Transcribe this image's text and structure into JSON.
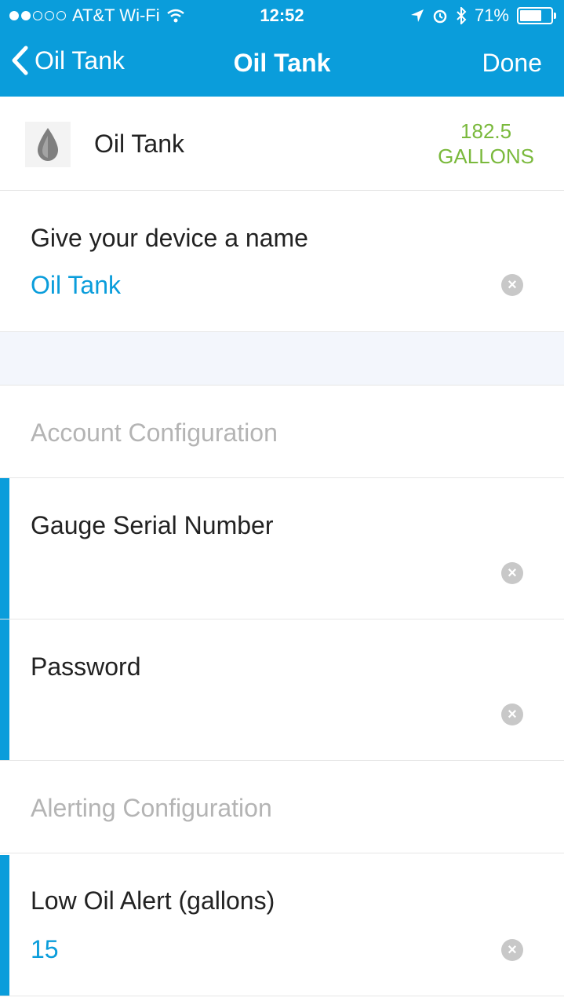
{
  "status_bar": {
    "carrier": "AT&T Wi-Fi",
    "time": "12:52",
    "battery": "71%",
    "battery_level": 0.71
  },
  "nav": {
    "back_label": "Oil Tank",
    "title": "Oil Tank",
    "done_label": "Done"
  },
  "device": {
    "name": "Oil Tank",
    "reading_value": "182.5",
    "reading_unit": "GALLONS",
    "icon": "oil-drop-icon"
  },
  "name_field": {
    "label": "Give your device a name",
    "value": "Oil Tank"
  },
  "account_section": {
    "title": "Account Configuration",
    "serial_label": "Gauge Serial Number",
    "serial_value": "",
    "password_label": "Password",
    "password_value": ""
  },
  "alert_section": {
    "title": "Alerting Configuration",
    "low_oil_label": "Low Oil Alert (gallons)",
    "low_oil_value": "15"
  },
  "colors": {
    "accent": "#0a9ddb",
    "reading": "#7ab93c"
  }
}
